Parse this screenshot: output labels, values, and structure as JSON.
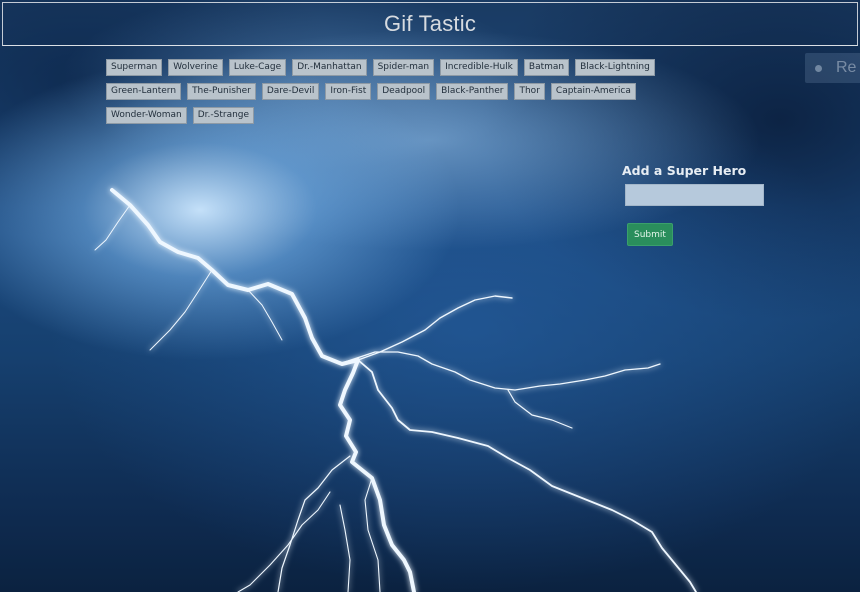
{
  "page": {
    "title": "Gif Tastic"
  },
  "heroes": [
    "Superman",
    "Wolverine",
    "Luke-Cage",
    "Dr.-Manhattan",
    "Spider-man",
    "Incredible-Hulk",
    "Batman",
    "Black-Lightning",
    "Green-Lantern",
    "The-Punisher",
    "Dare-Devil",
    "Iron-Fist",
    "Deadpool",
    "Black-Panther",
    "Thor",
    "Captain-America",
    "Wonder-Woman",
    "Dr.-Strange"
  ],
  "form": {
    "title": "Add a Super Hero",
    "input_value": "",
    "input_placeholder": "",
    "submit_label": "Submit"
  },
  "overlay": {
    "text": "Re"
  },
  "colors": {
    "accent_green": "#2a8e5c",
    "hero_button_bg": "#b9c3cb",
    "title_text": "#d7dbe0"
  }
}
